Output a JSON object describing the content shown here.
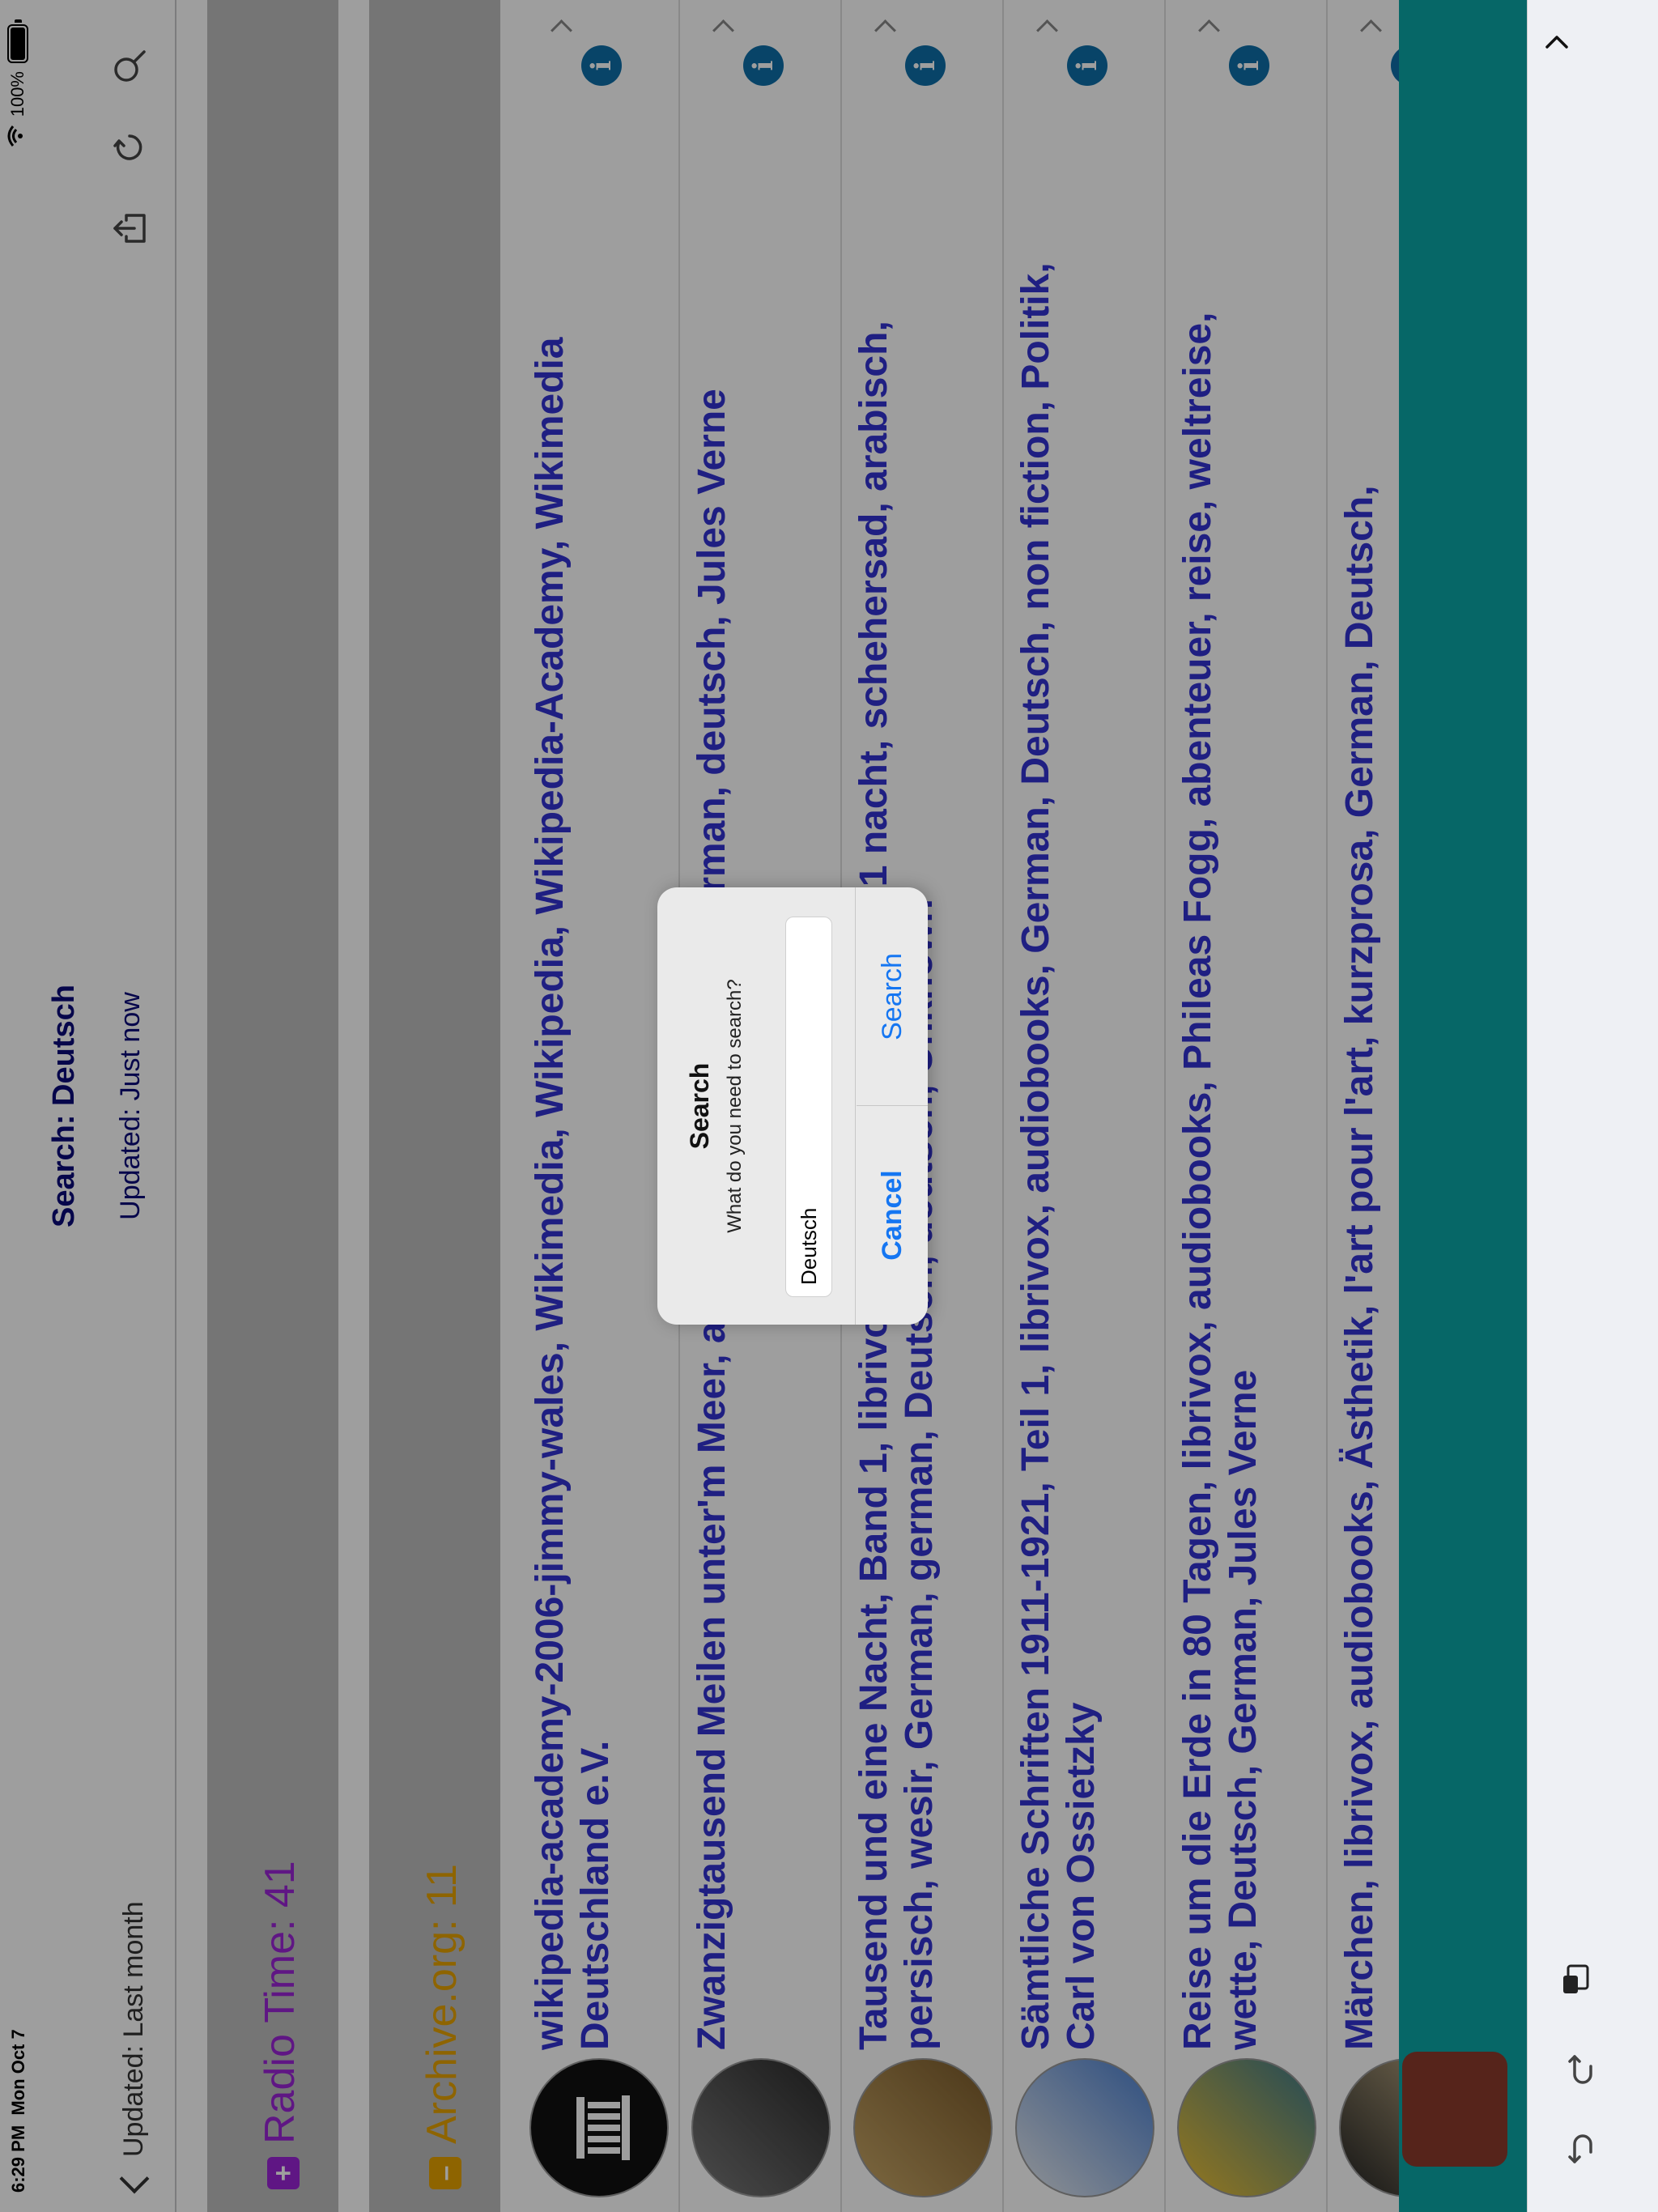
{
  "status": {
    "time": "6:29 PM",
    "date": "Mon Oct 7",
    "battery_pct": "100%"
  },
  "nav": {
    "back_label": "Updated: Last month",
    "title": "Search: Deutsch",
    "subtitle": "Updated: Just now",
    "icons": [
      "share-icon",
      "refresh-icon",
      "search-icon"
    ]
  },
  "sections": [
    {
      "icon": "+",
      "label": "Radio Time:  41",
      "color": "#9a25d6"
    },
    {
      "icon": "–",
      "label": "Archive.org:  11",
      "color": "#e6a200"
    }
  ],
  "results": [
    {
      "text": "wikipedia-academy-2006-jimmy-wales, Wikimedia, Wikipedia, Wikipedia-Academy, Wikimedia Deutschland e.V.",
      "thumb": "archive-logo"
    },
    {
      "text": "Zwanzigtausend Meilen unter'm Meer, audiobook, Hörbuch, German, deutsch, Jules Verne",
      "thumb": "book-cover"
    },
    {
      "text": "Tausend und eine Nacht, Band 1, librivox, märchen, sultan, 1001 nacht, schehersad, arabisch, persisch, wesir, German, german, Deutsch, deutsch, Unknown",
      "thumb": "book-cover"
    },
    {
      "text": "Sämtliche Schriften 1911-1921, Teil 1, librivox, audiobooks, German, Deutsch, non fiction, Politik, Carl von Ossietzky",
      "thumb": "book-cover"
    },
    {
      "text": "Reise um die Erde in 80 Tagen, librivox, audiobooks, Phileas Fogg, abenteuer, reise, weltreise, wette, Deutsch, German, Jules Verne",
      "thumb": "book-cover"
    },
    {
      "text": "Märchen, librivox, audiobooks, Ästhetik, l'art pour l'art, kurzprosa, German, Deutsch,",
      "thumb": "book-cover"
    }
  ],
  "dialog": {
    "title": "Search",
    "message": "What do you need to search?",
    "input_value": "Deutsch",
    "cancel_label": "Cancel",
    "search_label": "Search"
  },
  "colors": {
    "teal": "#0aa7a7",
    "link_blue": "#1576f2",
    "title_navy": "#0b0b7a",
    "result_blue": "#3333d2"
  }
}
